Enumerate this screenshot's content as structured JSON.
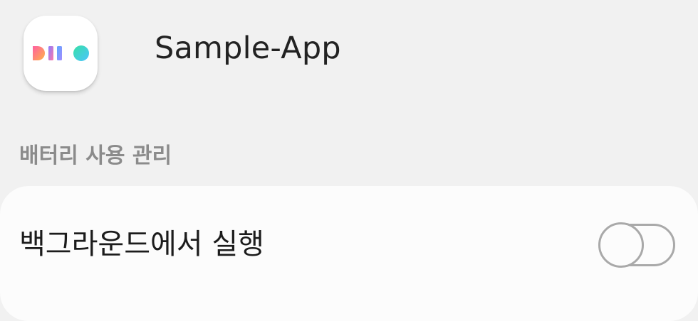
{
  "app": {
    "name": "Sample-App",
    "icon": "app-logo-icon"
  },
  "section": {
    "label": "배터리 사용 관리"
  },
  "settings": [
    {
      "label": "백그라운드에서 실행",
      "enabled": false
    }
  ],
  "colors": {
    "background": "#f1f1f1",
    "card": "#fcfcfc",
    "section_label": "#8b8b8b",
    "toggle_off": "#a9a9a9"
  }
}
